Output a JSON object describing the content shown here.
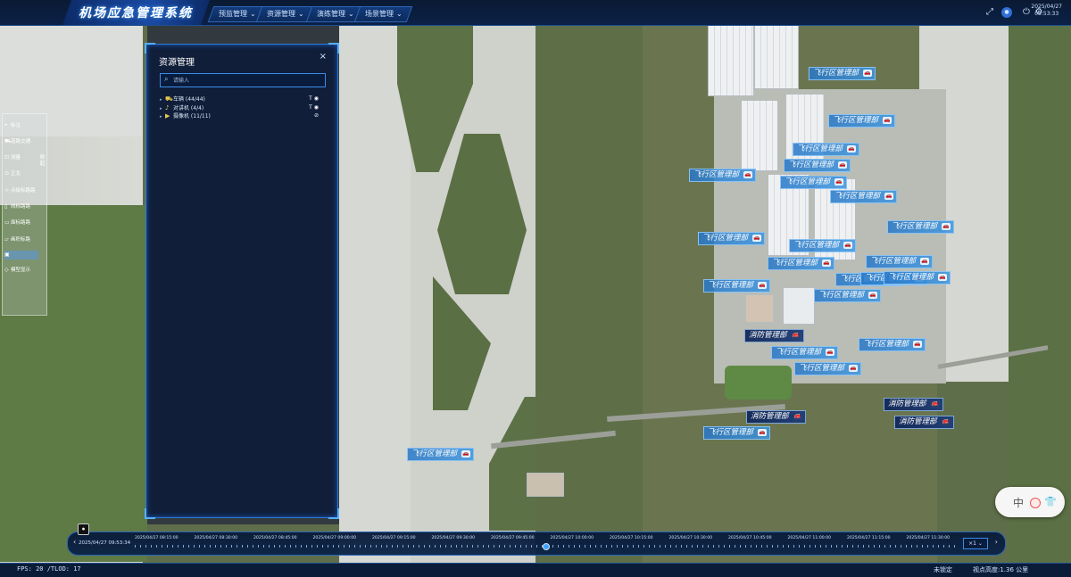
{
  "app": {
    "title": "机场应急管理系统",
    "menus": [
      "预监管理",
      "资源管理",
      "演练管理",
      "场景管理"
    ],
    "clock_date": "2025/04/27",
    "clock_time": "09:53:33",
    "top_icons": [
      "fullscreen-icon",
      "user-badge-icon",
      "power-icon",
      "settings-icon"
    ]
  },
  "toolbar": {
    "items": [
      {
        "label": "标注",
        "icon": "tag-icon"
      },
      {
        "label": "道路交通",
        "icon": "road-icon"
      },
      {
        "label": "测量",
        "icon": "ruler-icon"
      },
      {
        "label": "正北",
        "icon": "compass-icon"
      },
      {
        "label": "点绘标路路",
        "icon": "point-path-icon"
      },
      {
        "label": "线标路路",
        "icon": "line-path-icon"
      },
      {
        "label": "面标路路",
        "icon": "area-path-icon"
      },
      {
        "label": "画积标路",
        "icon": "draw-area-icon"
      },
      {
        "label": "",
        "icon": "active-tool-icon"
      },
      {
        "label": "模型显示",
        "icon": "model-icon"
      }
    ],
    "collapse_label": "收起"
  },
  "resource_panel": {
    "title": "资源管理",
    "close_label": "×",
    "search_placeholder": "请输入",
    "tree": [
      {
        "label": "车辆 (44/44)",
        "icon": "vehicle-icon",
        "text_toggle": "T",
        "visible": true
      },
      {
        "label": "对讲机 (4/4)",
        "icon": "radio-icon",
        "text_toggle": "T",
        "visible": true
      },
      {
        "label": "摄像机 (11/11)",
        "icon": "camera-icon",
        "text_toggle": "",
        "visible": false
      }
    ]
  },
  "map_labels": [
    {
      "text": "飞行区管理部",
      "type": "flight"
    },
    {
      "text": "飞行区管理部",
      "type": "flight"
    },
    {
      "text": "飞行区管理部",
      "type": "flight"
    },
    {
      "text": "飞行区管理部",
      "type": "flight"
    },
    {
      "text": "飞行区管理部",
      "type": "flight"
    },
    {
      "text": "飞行区管理部",
      "type": "flight"
    },
    {
      "text": "飞行区管理部",
      "type": "flight"
    },
    {
      "text": "飞行区管理部",
      "type": "flight"
    },
    {
      "text": "飞行区管理部",
      "type": "flight"
    },
    {
      "text": "飞行区管理部",
      "type": "flight"
    },
    {
      "text": "飞行区管理部",
      "type": "flight"
    },
    {
      "text": "飞行区管理部",
      "type": "flight"
    },
    {
      "text": "飞行区管理部",
      "type": "flight"
    },
    {
      "text": "飞行区管理部",
      "type": "flight"
    },
    {
      "text": "飞行区管理部",
      "type": "flight"
    },
    {
      "text": "飞行区管理部",
      "type": "flight"
    },
    {
      "text": "飞行区管理部",
      "type": "flight"
    },
    {
      "text": "飞行区管理部",
      "type": "flight"
    },
    {
      "text": "飞行区管理部",
      "type": "flight"
    },
    {
      "text": "飞行区管理部",
      "type": "flight"
    },
    {
      "text": "消防管理部",
      "type": "fire"
    },
    {
      "text": "消防管理部",
      "type": "fire"
    },
    {
      "text": "消防管理部",
      "type": "fire"
    },
    {
      "text": "消防管理部",
      "type": "fire"
    },
    {
      "text": "飞行区管理部",
      "type": "flight"
    },
    {
      "text": "飞行区管理部",
      "type": "flight"
    }
  ],
  "timeline": {
    "current": "2025/04/27 09:53:34",
    "ticks": [
      "2025/04/27 08:15:00",
      "2025/04/27 08:30:00",
      "2025/04/27 08:45:00",
      "2025/04/27 09:00:00",
      "2025/04/27 09:15:00",
      "2025/04/27 09:30:00",
      "2025/04/27 09:45:00",
      "2025/04/27 10:00:00",
      "2025/04/27 10:15:00",
      "2025/04/27 10:30:00",
      "2025/04/27 10:45:00",
      "2025/04/27 11:00:00",
      "2025/04/27 11:15:00",
      "2025/04/27 11:30:00"
    ],
    "speed": "×1"
  },
  "status": {
    "fps": "FPS: 20 /TLOD: 17",
    "lock": "未锁定",
    "view_height": "视点高度:1.36 公里"
  },
  "ime": {
    "lang": "中"
  }
}
